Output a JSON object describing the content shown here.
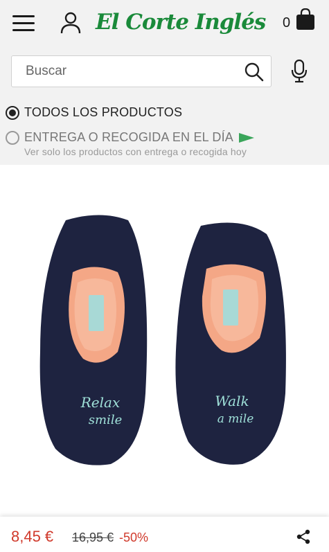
{
  "header": {
    "menu_icon": "hamburger-menu-icon",
    "user_icon": "user-account-icon",
    "logo_text": "El Corte Inglés",
    "cart_count": "0",
    "bag_icon": "shopping-bag-icon",
    "brand_color": "#1a8a3a"
  },
  "search": {
    "placeholder": "Buscar",
    "value": "",
    "search_icon": "search-icon",
    "mic_icon": "microphone-icon"
  },
  "filters": {
    "options": [
      {
        "label": "TODOS LOS PRODUCTOS",
        "selected": true
      },
      {
        "label": "ENTREGA O RECOGIDA EN EL DÍA",
        "selected": false,
        "icon": "flag-icon"
      }
    ],
    "subtext": "Ver solo los productos con entrega o recogida hoy",
    "flag_color": "#3aa55a"
  },
  "product": {
    "left_slipper_text_1": "Relax",
    "left_slipper_text_2": "smile",
    "right_slipper_text_1": "Walk",
    "right_slipper_text_2": "a mile"
  },
  "price": {
    "current": "8,45 €",
    "old": "16,95 €",
    "discount": "-50%",
    "sale_color": "#d0392b",
    "share_icon": "share-icon"
  }
}
